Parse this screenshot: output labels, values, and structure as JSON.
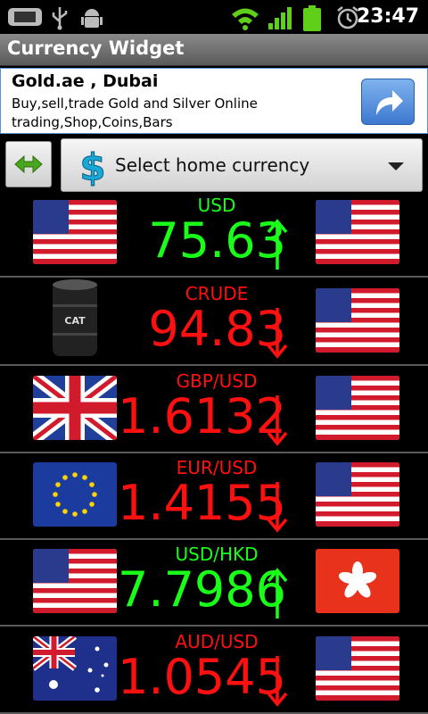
{
  "status_bar": {
    "time": "23:47",
    "icons": [
      "screen-icon",
      "usb-icon",
      "android-debug-icon",
      "wifi-icon",
      "signal-icon",
      "battery-icon",
      "alarm-icon"
    ]
  },
  "app": {
    "title": "Currency Widget"
  },
  "ad": {
    "title": "Gold.ae , Dubai",
    "text": "Buy,sell,trade Gold and Silver Online trading,Shop,Coins,Bars",
    "button_icon": "share-arrow-icon"
  },
  "controls": {
    "swap_icon": "swap-arrows-icon",
    "select_label": "Select home currency",
    "select_icon": "dollar-icon"
  },
  "colors": {
    "up": "#19ff19",
    "down": "#ff1010",
    "divider": "#5a5a5a",
    "title_bar": "#6e6e6e"
  },
  "rows": [
    {
      "label": "USD",
      "value": "75.63",
      "direction": "up",
      "left_flag": "us-flag",
      "right_flag": "us-flag"
    },
    {
      "label": "CRUDE",
      "value": "94.83",
      "direction": "down",
      "left_flag": "oil-barrel",
      "right_flag": "us-flag"
    },
    {
      "label": "GBP/USD",
      "value": "1.6132",
      "direction": "down",
      "left_flag": "uk-flag",
      "right_flag": "us-flag"
    },
    {
      "label": "EUR/USD",
      "value": "1.4155",
      "direction": "down",
      "left_flag": "eu-flag",
      "right_flag": "us-flag"
    },
    {
      "label": "USD/HKD",
      "value": "7.7986",
      "direction": "up",
      "left_flag": "us-flag",
      "right_flag": "hk-flag"
    },
    {
      "label": "AUD/USD",
      "value": "1.0545",
      "direction": "down",
      "left_flag": "au-flag",
      "right_flag": "us-flag"
    }
  ]
}
